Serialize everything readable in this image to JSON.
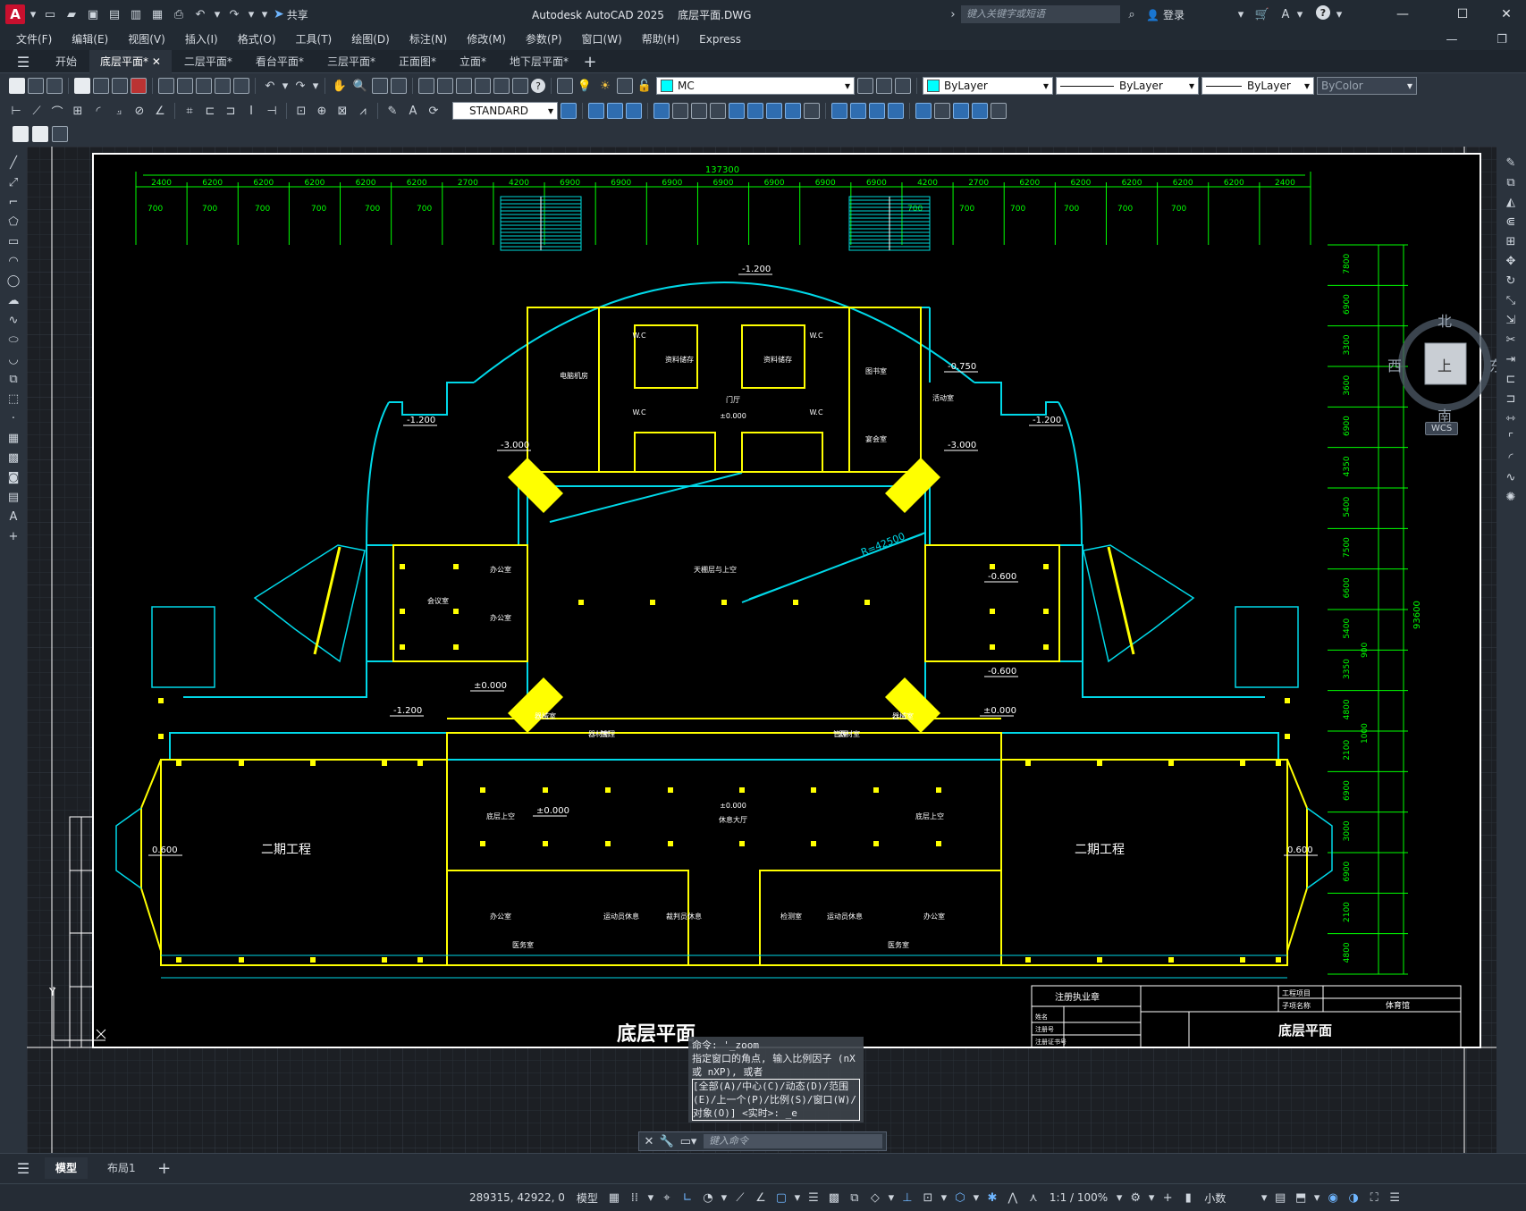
{
  "app": {
    "title": "Autodesk AutoCAD 2025    底层平面.DWG",
    "logo": "A",
    "share_label": "共享",
    "search_placeholder": "键入关键字或短语",
    "login_label": "登录"
  },
  "menu": [
    "文件(F)",
    "编辑(E)",
    "视图(V)",
    "插入(I)",
    "格式(O)",
    "工具(T)",
    "绘图(D)",
    "标注(N)",
    "修改(M)",
    "参数(P)",
    "窗口(W)",
    "帮助(H)",
    "Express"
  ],
  "tabs": [
    {
      "label": "开始",
      "active": false,
      "close": false
    },
    {
      "label": "底层平面*",
      "active": true,
      "close": true
    },
    {
      "label": "二层平面*",
      "active": false,
      "close": false
    },
    {
      "label": "看台平面*",
      "active": false,
      "close": false
    },
    {
      "label": "三层平面*",
      "active": false,
      "close": false
    },
    {
      "label": "正面图*",
      "active": false,
      "close": false
    },
    {
      "label": "立面*",
      "active": false,
      "close": false
    },
    {
      "label": "地下层平面*",
      "active": false,
      "close": false
    }
  ],
  "toolbar": {
    "layer_name": "MC",
    "color": "ByLayer",
    "linetype": "ByLayer",
    "lineweight": "ByLayer",
    "plotstyle": "ByColor",
    "textstyle": "STANDARD"
  },
  "viewcube": {
    "north": "北",
    "south": "南",
    "west": "西",
    "east": "东",
    "face": "上",
    "wcs": "WCS"
  },
  "drawing": {
    "total_dim": "137300",
    "top_dims": [
      "2400",
      "6200",
      "6200",
      "6200",
      "6200",
      "6200",
      "2700",
      "4200",
      "6900",
      "6900",
      "6900",
      "6900",
      "6900",
      "6900",
      "6900",
      "4200",
      "2700",
      "6200",
      "6200",
      "6200",
      "6200",
      "6200",
      "2400"
    ],
    "sub_dims": [
      "700",
      "700",
      "700",
      "700",
      "700",
      "700",
      "700",
      "700",
      "700",
      "700",
      "700",
      "700"
    ],
    "right_dims": [
      "7800",
      "6900",
      "3300",
      "3600",
      "6900",
      "4350",
      "5400",
      "7500",
      "6600",
      "5400",
      "3350",
      "4800",
      "2100",
      "6900",
      "3000",
      "6900",
      "2100",
      "4800"
    ],
    "right_total": "93600",
    "right_small": [
      "900",
      "1000"
    ],
    "elevations": [
      "-1.200",
      "-0.750",
      "-1.200",
      "-3.000",
      "-1.200",
      "-3.000",
      "-0.600",
      "±0.000",
      "-0.600",
      "±0.000",
      "-1.200",
      "±0.000",
      "0.600",
      "0.600"
    ],
    "radius": "R=42500",
    "rooms": [
      "W.C",
      "W.C",
      "W.C",
      "W.C",
      "电脑机房",
      "资料储存",
      "资料储存",
      "图书室",
      "门厅",
      "±0.000",
      "活动室",
      "宴会室",
      "会议室",
      "办公室",
      "办公室",
      "天棚层与上空",
      "器械室",
      "器材室",
      "器材室",
      "器械室",
      "二期工程",
      "二期工程",
      "±0.000",
      "休息大厅",
      "底层上空",
      "底层上空",
      "办公室",
      "运动员休息",
      "裁判员休息",
      "医务室",
      "检测室",
      "运动员休息",
      "办公室",
      "医务室",
      "管理",
      "管理"
    ],
    "plan_title": "底层平面",
    "title_block": {
      "firm_label": "注册执业章",
      "drawing_name": "底层平面",
      "project_label": "工程项目",
      "subproject_label": "子项名称",
      "subproject_value": "体育馆"
    },
    "titleblock_rows": [
      "姓名",
      "注册号",
      "注册证书号"
    ]
  },
  "command": {
    "history": [
      "命令: '_zoom",
      "指定窗口的角点, 输入比例因子 (nX 或 nXP), 或者",
      "[全部(A)/中心(C)/动态(D)/范围(E)/上一个(P)/比例(S)/窗口(W)/对象(O)] <实时>: _e"
    ],
    "placeholder": "键入命令"
  },
  "layout_tabs": [
    "模型",
    "布局1"
  ],
  "status": {
    "coords": "289315, 42922, 0",
    "space": "模型",
    "scale": "1:1 / 100%",
    "units": "小数"
  }
}
